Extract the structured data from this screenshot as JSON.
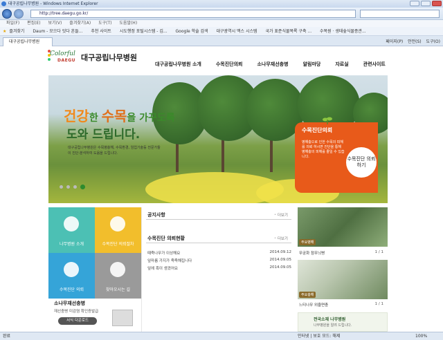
{
  "browser": {
    "window_title": "대구공립나무병원 - Windows Internet Explorer",
    "address": "http://tree.daegu.go.kr/",
    "menu": [
      "파일(F)",
      "편집(E)",
      "보기(V)",
      "즐겨찾기(A)",
      "도구(T)",
      "도움말(H)"
    ],
    "favorites": [
      "즐겨찾기",
      "Daum - 모으다 잇다 흔들...",
      "추천 사이트",
      "시도행정 포털시스템 - 김...",
      "Google 학술 검색",
      "대구광역시 맥스 시스템",
      "국가 표준식물목록 구축 ...",
      "수목원 · 생태숲식물종관..."
    ],
    "tab_title": "대구공립나무병원",
    "tab_tools": [
      "페이지(P)",
      "안전(S)",
      "도구(O)"
    ],
    "status_left": "완료",
    "status_zone": "인터넷 | 보호 모드: 해제",
    "status_zoom": "100%"
  },
  "site": {
    "logo_colorful": "Colorful",
    "logo_daegu": "DAEGU",
    "title": "대구공립나무병원",
    "nav": [
      "대구공립나무병원 소개",
      "수목진단의뢰",
      "소나무재선충병",
      "알림마당",
      "자료실",
      "관련사이트"
    ]
  },
  "hero": {
    "headline_parts": [
      {
        "text": "건강",
        "color": "#f08a1c"
      },
      {
        "text": "한 ",
        "color": "#3a8a2a"
      },
      {
        "text": "수목",
        "color": "#e0701a"
      },
      {
        "text": "을 가꾸도록",
        "color": "#3a8a2a"
      }
    ],
    "headline_line2": "도와 드립니다.",
    "description": "대구공립나무병원은 수목병충해, 수목환경, 임업기술등 전문가들이 진단·분석하여 도움을 드립니다.",
    "diag_title": "수목진단의뢰",
    "diag_text": "병해충으로 인한 수목의 피해를 의뢰 하시면 진단을 통해 병해충의 피해를 줄일 수 있습니다.",
    "diag_button": "수목진단 의뢰하기"
  },
  "tiles": [
    {
      "label": "나무병원 소개",
      "color": "#4cc0b4",
      "icon": "tree-icon"
    },
    {
      "label": "수목진단 의뢰절차",
      "color": "#f2be2c",
      "icon": "clipboard-icon"
    },
    {
      "label": "수목진단 의뢰",
      "color": "#35a4d8",
      "icon": "drop-icon"
    },
    {
      "label": "찾아오시는 길",
      "color": "#9a9a9a",
      "icon": "car-icon"
    }
  ],
  "sonamu": {
    "title": "소나무재선충병",
    "sub": "재선충병 미감염 확인증발급",
    "button": "서식 다운로드"
  },
  "notice": {
    "title": "공지사항",
    "more": "더보기",
    "request_title": "수목진단 의뢰현황",
    "items": [
      {
        "text": "때죽나무가 이상해요",
        "date": "2014.09.12"
      },
      {
        "text": "잎마름 가지가 죽죽해집니다",
        "date": "2014.09.05"
      },
      {
        "text": "잎에 흑이 생겼어요",
        "date": "2014.09.05"
      }
    ]
  },
  "gallery": {
    "tag1": "주요병해",
    "caption1": "무궁화 점무늬병",
    "page1": "1 / 1",
    "tag2": "주요충해",
    "caption2": "느티나무 외줄면충",
    "page2": "1 / 1",
    "jeonguk_title": "전국소재 나무병원",
    "jeonguk_sub": "나무병원을 알려 드립니다."
  }
}
